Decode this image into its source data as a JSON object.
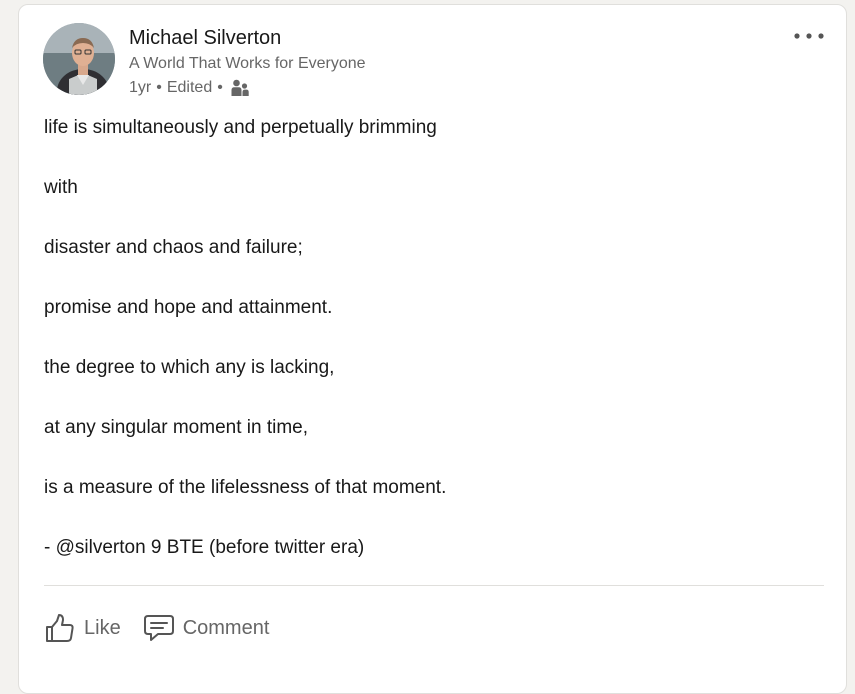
{
  "post": {
    "author": {
      "name": "Michael Silverton",
      "headline": "A World That Works for Everyone"
    },
    "meta": {
      "age": "1yr",
      "separator": "•",
      "edited": "Edited",
      "audience_icon": "connections-icon"
    },
    "more_icon": "more-horizontal-icon",
    "lines": [
      "life is simultaneously and perpetually brimming",
      "with",
      "disaster and chaos and failure;",
      "promise and hope and attainment.",
      "the degree to which any is lacking,",
      "at any singular moment in time,",
      "is a measure of the lifelessness of that moment.",
      "- @silverton 9 BTE (before twitter era)"
    ]
  },
  "actions": {
    "like_label": "Like",
    "like_icon": "thumbs-up-icon",
    "comment_label": "Comment",
    "comment_icon": "comment-icon"
  },
  "colors": {
    "page_background": "#f3f2ef",
    "card_background": "#ffffff",
    "primary_text": "#191919",
    "secondary_text": "#666666"
  }
}
